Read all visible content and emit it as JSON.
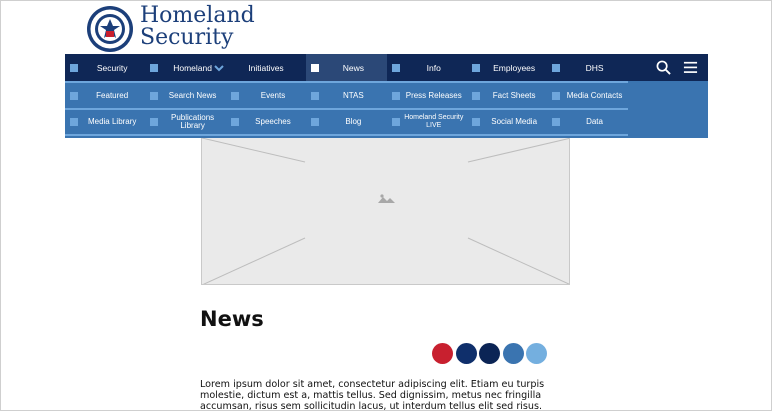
{
  "brand": {
    "line1": "Homeland",
    "line2": "Security",
    "seal_text": "U.S. DEPARTMENT OF HOMELAND SECURITY",
    "color": "#1c3f7a"
  },
  "nav": {
    "primary": [
      {
        "label": "Security"
      },
      {
        "label": "Homeland"
      },
      {
        "label": "Initiatives"
      },
      {
        "label": "News",
        "active": true
      },
      {
        "label": "Info"
      },
      {
        "label": "Employees"
      },
      {
        "label": "DHS"
      }
    ],
    "sub_row_1": [
      {
        "label": "Featured"
      },
      {
        "label": "Search News"
      },
      {
        "label": "Events"
      },
      {
        "label": "NTAS"
      },
      {
        "label": "Press Releases"
      },
      {
        "label": "Fact Sheets"
      },
      {
        "label": "Media Contacts"
      }
    ],
    "sub_row_2": [
      {
        "label": "Media Library"
      },
      {
        "label": "Publications Library"
      },
      {
        "label": "Speeches"
      },
      {
        "label": "Blog"
      },
      {
        "label": "Homeland Security LIVE"
      },
      {
        "label": "Social Media"
      },
      {
        "label": "Data"
      }
    ],
    "tools": {
      "search_icon": "search-icon",
      "menu_icon": "hamburger-menu-icon"
    },
    "colors": {
      "dark": "#0f2756",
      "mid": "#3a74b0",
      "light": "#6ea6dc"
    }
  },
  "main": {
    "image_icon": "image-placeholder-icon",
    "title": "News",
    "swatches": [
      "#c8202f",
      "#0f2f6b",
      "#0b2455",
      "#3a74b0",
      "#74afdf"
    ],
    "paragraph": "Lorem ipsum dolor sit amet, consectetur adipiscing elit. Etiam eu turpis molestie, dictum est a, mattis tellus. Sed dignissim, metus nec fringilla accumsan, risus sem sollicitudin lacus, ut interdum tellus elit sed risus. Maecenas eget condimentum velit,"
  }
}
